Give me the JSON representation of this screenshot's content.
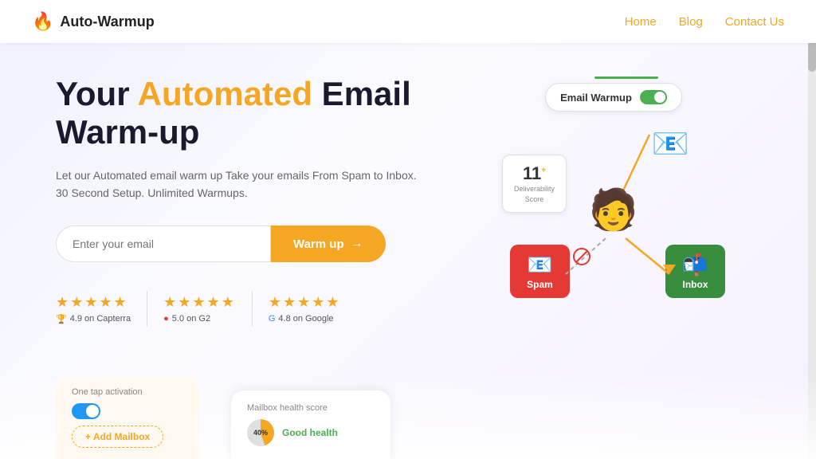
{
  "brand": {
    "logo_text": "Auto-Warmup",
    "logo_icon": "🔥"
  },
  "nav": {
    "items": [
      {
        "label": "Home",
        "href": "#"
      },
      {
        "label": "Blog",
        "href": "#"
      },
      {
        "label": "Contact Us",
        "href": "#"
      }
    ]
  },
  "hero": {
    "headline_part1": "Your ",
    "headline_part2": "Automated",
    "headline_part3": " Email Warm-up",
    "subtitle_line1": "Let our Automated email warm up Take your emails From Spam to Inbox.",
    "subtitle_line2": "30 Second Setup. Unlimited Warmups.",
    "input_placeholder": "Enter your email",
    "cta_button_label": "Warm up",
    "cta_button_arrow": "→"
  },
  "ratings": [
    {
      "stars": "★★★★★",
      "score": "4.9",
      "platform": "Capterra",
      "icon": "🏆"
    },
    {
      "stars": "★★★★★",
      "score": "5.0",
      "platform": "G2",
      "icon": "🔴"
    },
    {
      "stars": "★★★★★",
      "score": "4.8",
      "platform": "Google",
      "icon": "🔵"
    }
  ],
  "illustration": {
    "toggle_label": "Email Warmup",
    "score_number": "11",
    "score_sup": "+",
    "score_label_line1": "Deliverability",
    "score_label_line2": "Score",
    "spam_label": "Spam",
    "inbox_label": "Inbox"
  },
  "bottom_cards": {
    "activation_title": "One tap activation",
    "health_title": "Mailbox health score",
    "health_value": "40%",
    "health_label": "Good health",
    "add_mailbox_label": "+ Add Mailbox"
  }
}
